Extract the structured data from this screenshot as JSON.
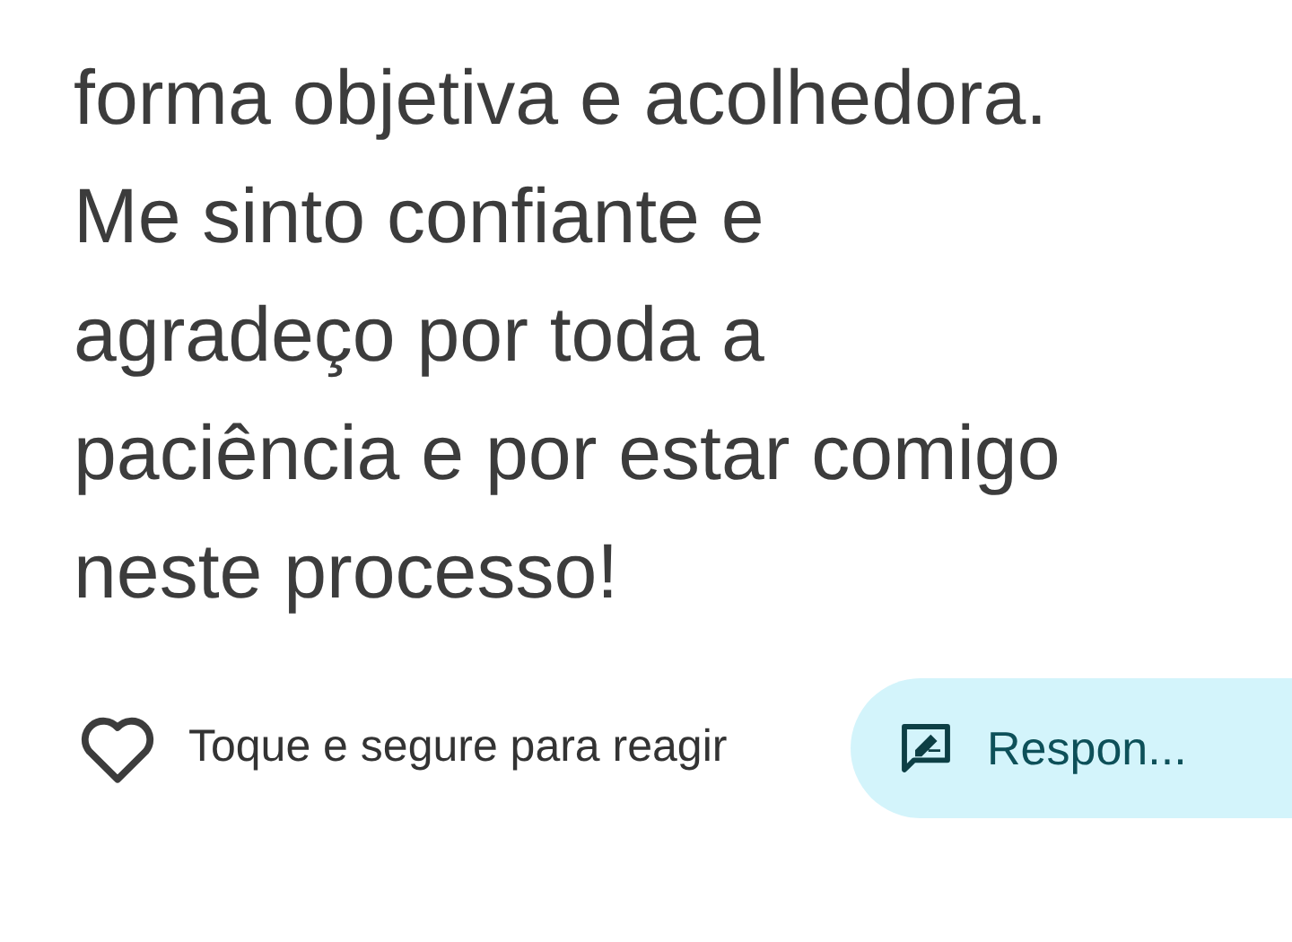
{
  "message": {
    "lines": [
      "forma objetiva e acolhedora.",
      "Me sinto confiante e",
      "agradeço por toda a",
      "paciência e por estar comigo",
      "neste processo!"
    ]
  },
  "reaction_hint": "Toque e segure para reagir",
  "reply_button": {
    "label": "Respon..."
  }
}
